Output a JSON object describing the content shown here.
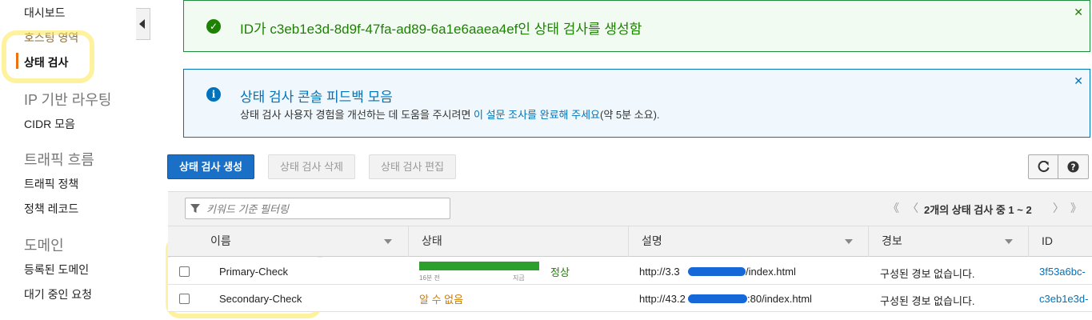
{
  "sidebar": {
    "items": [
      {
        "label": "대시보드"
      },
      {
        "label": "호스팅 영역"
      },
      {
        "label": "상태 검사"
      }
    ],
    "sections": [
      {
        "heading": "IP 기반 라우팅",
        "items": [
          "CIDR 모음"
        ]
      },
      {
        "heading": "트래픽 흐름",
        "items": [
          "트래픽 정책",
          "정책 레코드"
        ]
      },
      {
        "heading": "도메인",
        "items": [
          "등록된 도메인",
          "대기 중인 요청"
        ]
      }
    ],
    "active_color": "#ec7211"
  },
  "success_alert": {
    "message": "ID가 c3eb1e3d-8d9f-47fa-ad89-6a1e6aaea4ef인 상태 검사를 생성함",
    "color": "#1d8102"
  },
  "info_alert": {
    "title": "상태 검사 콘솔 피드백 모음",
    "body_prefix": "상태 검사 사용자 경험을 개선하는 데 도움을 주시려면 ",
    "body_link": "이 설문 조사를 완료해 주세요",
    "body_suffix": "(약 5분 소요).",
    "color": "#0073bb"
  },
  "toolbar": {
    "create_label": "상태 검사 생성",
    "delete_label": "상태 검사 삭제",
    "edit_label": "상태 검사 편집"
  },
  "filter": {
    "placeholder": "키워드 기준 필터링"
  },
  "pagination": {
    "text": "2개의 상태 검사 중 1 ~ 2"
  },
  "table": {
    "columns": [
      "이름",
      "상태",
      "설명",
      "경보",
      "ID"
    ],
    "rows": [
      {
        "name": "Primary-Check",
        "status": "정상",
        "bar_left_label": "16분 전",
        "bar_right_label": "지금",
        "description_start": "http://3.3",
        "description_end": "/index.html",
        "alarm": "구성된 경보 없습니다.",
        "id": "3f53a6bc-"
      },
      {
        "name": "Secondary-Check",
        "status": "알 수 없음",
        "description_start": "http://43.2",
        "description_end": ":80/index.html",
        "alarm": "구성된 경보 없습니다.",
        "id": "c3eb1e3d-"
      }
    ]
  }
}
